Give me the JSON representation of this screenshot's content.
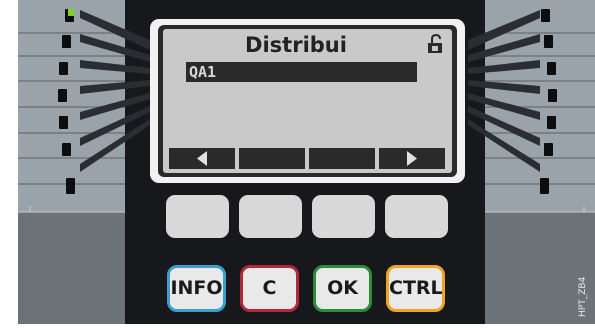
{
  "display": {
    "title": "Distribui",
    "selected_item": "QA1",
    "lock_icon": "unlocked-padlock-icon",
    "softkey_icons": [
      "left-arrow-icon",
      "blank",
      "blank",
      "right-arrow-icon"
    ]
  },
  "keys": {
    "info": "INFO",
    "c": "C",
    "ok": "OK",
    "ctrl": "CTRL"
  },
  "colors": {
    "info_border": "#3a9ed0",
    "c_border": "#b3283a",
    "ok_border": "#2e8b3a",
    "ctrl_border": "#f0a424",
    "led_active": "#7ed321"
  },
  "figure_code": "HPT_ZB4"
}
